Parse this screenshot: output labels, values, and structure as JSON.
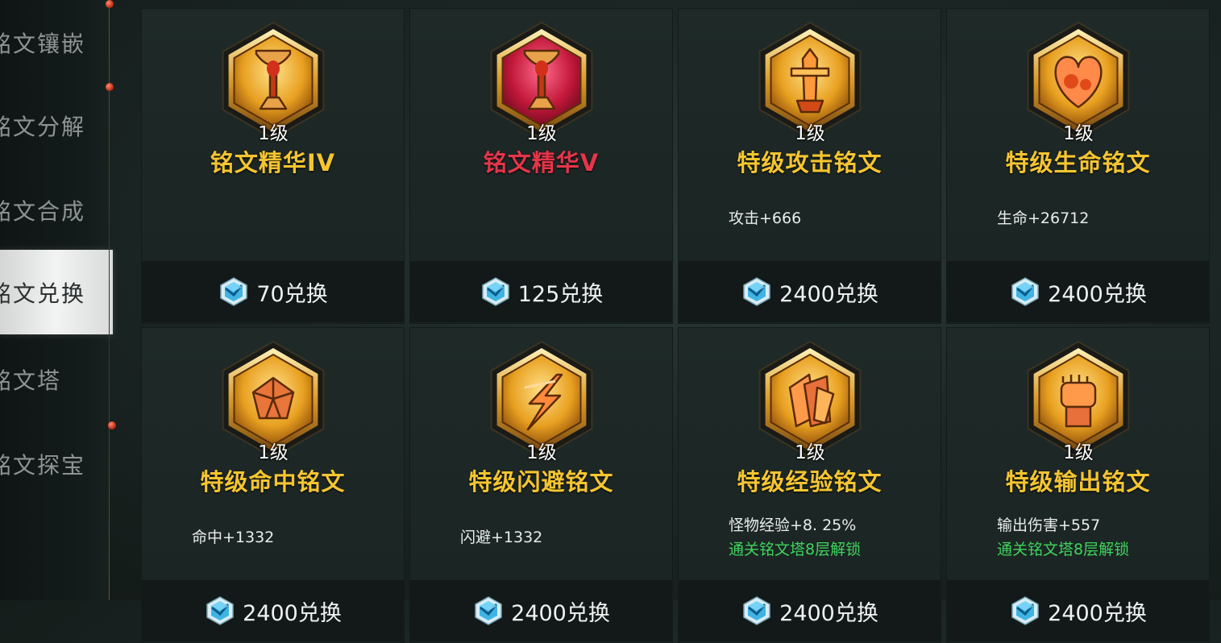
{
  "sidebar": {
    "items": [
      {
        "label": "铭文镶嵌"
      },
      {
        "label": "铭文分解"
      },
      {
        "label": "铭文合成"
      },
      {
        "label": "铭文兑换",
        "active": true
      },
      {
        "label": "铭文塔"
      },
      {
        "label": "铭文探宝"
      }
    ]
  },
  "cards": [
    {
      "name": "铭文精华IV",
      "level": "1级",
      "color": "#f5c531",
      "emblem": "goblet-icon",
      "stat": "",
      "unlock": "",
      "cost": "70兑换"
    },
    {
      "name": "铭文精华V",
      "level": "1级",
      "color": "#e5354a",
      "emblem": "goblet-icon",
      "stat": "",
      "unlock": "",
      "cost": "125兑换"
    },
    {
      "name": "特级攻击铭文",
      "level": "1级",
      "color": "#f5c531",
      "emblem": "sword-icon",
      "stat": "攻击+666",
      "unlock": "",
      "cost": "2400兑换"
    },
    {
      "name": "特级生命铭文",
      "level": "1级",
      "color": "#f5c531",
      "emblem": "heart-icon",
      "stat": "生命+26712",
      "unlock": "",
      "cost": "2400兑换"
    },
    {
      "name": "特级命中铭文",
      "level": "1级",
      "color": "#f5c531",
      "emblem": "crystal-icon",
      "stat": "命中+1332",
      "unlock": "",
      "cost": "2400兑换"
    },
    {
      "name": "特级闪避铭文",
      "level": "1级",
      "color": "#f5c531",
      "emblem": "lightning-icon",
      "stat": "闪避+1332",
      "unlock": "",
      "cost": "2400兑换"
    },
    {
      "name": "特级经验铭文",
      "level": "1级",
      "color": "#f5c531",
      "emblem": "cards-icon",
      "stat": "怪物经验+8. 25%",
      "unlock": "通关铭文塔8层解锁",
      "cost": "2400兑换"
    },
    {
      "name": "特级输出铭文",
      "level": "1级",
      "color": "#f5c531",
      "emblem": "fist-icon",
      "stat": "输出伤害+557",
      "unlock": "通关铭文塔8层解锁",
      "cost": "2400兑换"
    }
  ]
}
